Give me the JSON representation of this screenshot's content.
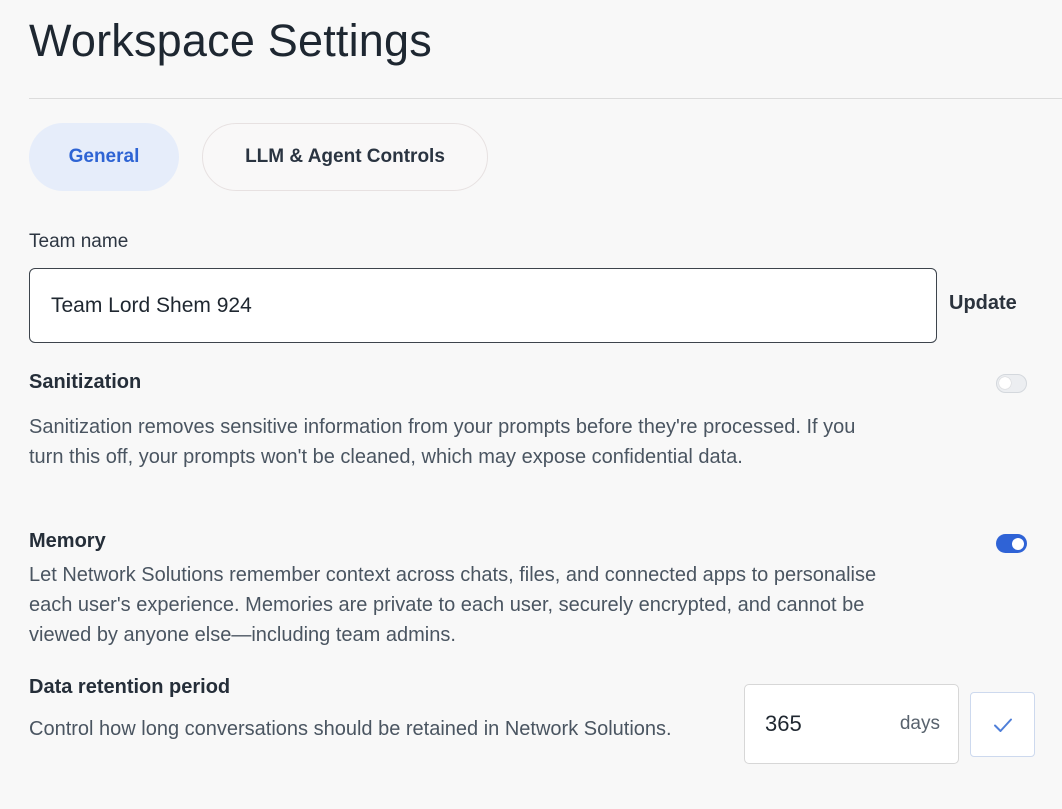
{
  "page": {
    "title": "Workspace Settings"
  },
  "tabs": [
    {
      "label": "General",
      "active": true
    },
    {
      "label": "LLM & Agent Controls",
      "active": false
    }
  ],
  "team": {
    "label": "Team name",
    "value": "Team Lord Shem 924",
    "update_label": "Update"
  },
  "sanitization": {
    "title": "Sanitization",
    "description": "Sanitization removes sensitive information from your prompts before they're processed. If you turn this off, your prompts won't be cleaned, which may expose confidential data.",
    "enabled": false
  },
  "memory": {
    "title": "Memory",
    "description": "Let Network Solutions remember context across chats, files, and connected apps to personalise each user's experience. Memories are private to each user, securely encrypted, and cannot be viewed by anyone else—including team admins.",
    "enabled": true
  },
  "retention": {
    "title": "Data retention period",
    "description": "Control how long conversations should be retained in Network Solutions.",
    "value": "365",
    "unit": "days",
    "confirm_icon": "check-icon"
  },
  "colors": {
    "accent": "#2f63d6",
    "active_tab_bg": "#e6edfa",
    "active_tab_text": "#2e64d4"
  }
}
